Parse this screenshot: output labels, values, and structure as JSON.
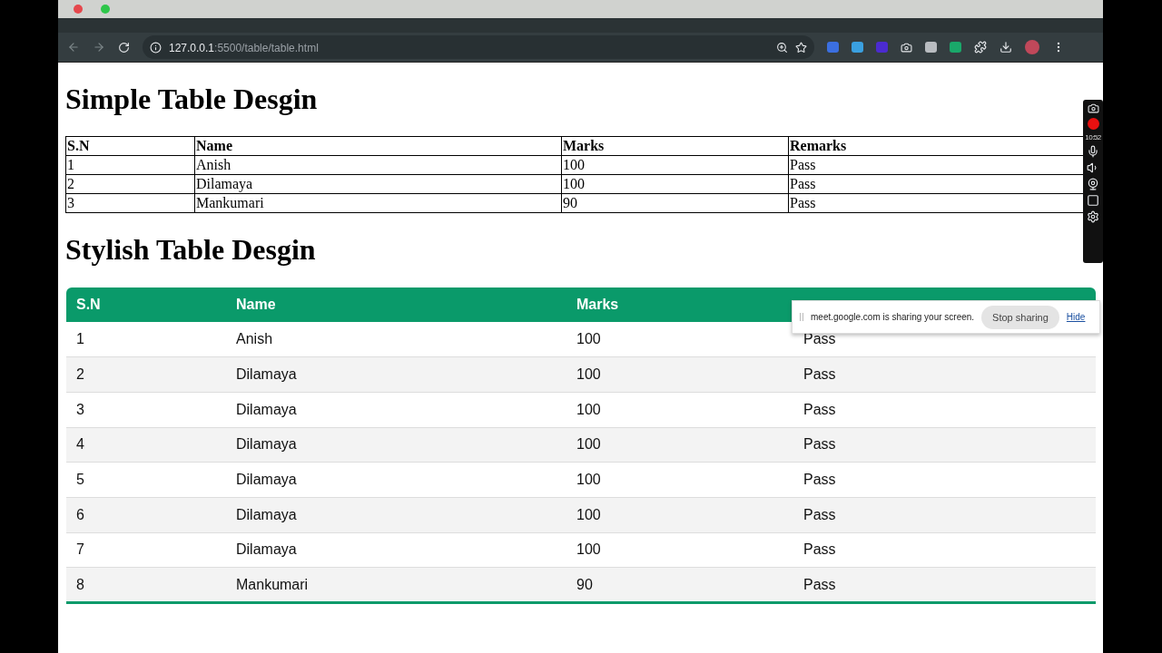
{
  "browser": {
    "url_host": "127.0.0.1",
    "url_path": ":5500/table/table.html"
  },
  "recorder": {
    "time": "10:52"
  },
  "simple_table": {
    "title": "Simple Table Desgin",
    "columns": [
      "S.N",
      "Name",
      "Marks",
      "Remarks"
    ],
    "rows": [
      [
        "1",
        "Anish",
        "100",
        "Pass"
      ],
      [
        "2",
        "Dilamaya",
        "100",
        "Pass"
      ],
      [
        "3",
        "Mankumari",
        "90",
        "Pass"
      ]
    ]
  },
  "stylish_table": {
    "title": "Stylish Table Desgin",
    "columns": [
      "S.N",
      "Name",
      "Marks"
    ],
    "rows": [
      [
        "1",
        "Anish",
        "100",
        "Pass"
      ],
      [
        "2",
        "Dilamaya",
        "100",
        "Pass"
      ],
      [
        "3",
        "Dilamaya",
        "100",
        "Pass"
      ],
      [
        "4",
        "Dilamaya",
        "100",
        "Pass"
      ],
      [
        "5",
        "Dilamaya",
        "100",
        "Pass"
      ],
      [
        "6",
        "Dilamaya",
        "100",
        "Pass"
      ],
      [
        "7",
        "Dilamaya",
        "100",
        "Pass"
      ],
      [
        "8",
        "Mankumari",
        "90",
        "Pass"
      ]
    ]
  },
  "share_banner": {
    "message": "meet.google.com is sharing your screen.",
    "stop_button": "Stop sharing",
    "hide_link": "Hide"
  }
}
